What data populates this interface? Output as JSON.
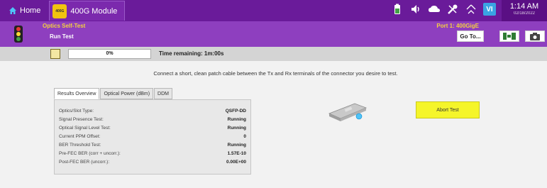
{
  "topbar": {
    "home_label": "Home",
    "module_label": "400G Module",
    "module_chip_text": "400G",
    "vi_label": "VI",
    "time": "1:14 AM",
    "date": "02/18/2022"
  },
  "header": {
    "app_title": "Optics Self-Test",
    "subtitle": "Run Test",
    "port": "Port 1: 400GigE",
    "goto_label": "Go To..."
  },
  "progress": {
    "percent_label": "0%",
    "fraction": 0,
    "time_remaining": "Time remaining: 1m:00s"
  },
  "instruction": "Connect a short, clean patch cable between the Tx and Rx terminals of the connector you desire to test.",
  "tabs": [
    {
      "label": "Results Overview",
      "active": true
    },
    {
      "label": "Optical Power (dBm)",
      "active": false
    },
    {
      "label": "DDM",
      "active": false
    }
  ],
  "results": [
    {
      "label": "Optics/Slot Type:",
      "value": "QSFP-DD"
    },
    {
      "label": "Signal Presence Test:",
      "value": "Running"
    },
    {
      "label": "Optical Signal Level Test:",
      "value": "Running"
    },
    {
      "label": "Current PPM Offset:",
      "value": "0"
    },
    {
      "label": "BER Threshold Test:",
      "value": "Running"
    },
    {
      "label": "Pre-FEC BER (corr + uncorr.):",
      "value": "1.57E-10"
    },
    {
      "label": "Post-FEC BER (uncorr.):",
      "value": "0.00E+00"
    }
  ],
  "abort_label": "Abort Test",
  "colors": {
    "topbar": "#6a1b9a",
    "header": "#8e3fbf",
    "accent_yellow": "#f5f52a"
  }
}
